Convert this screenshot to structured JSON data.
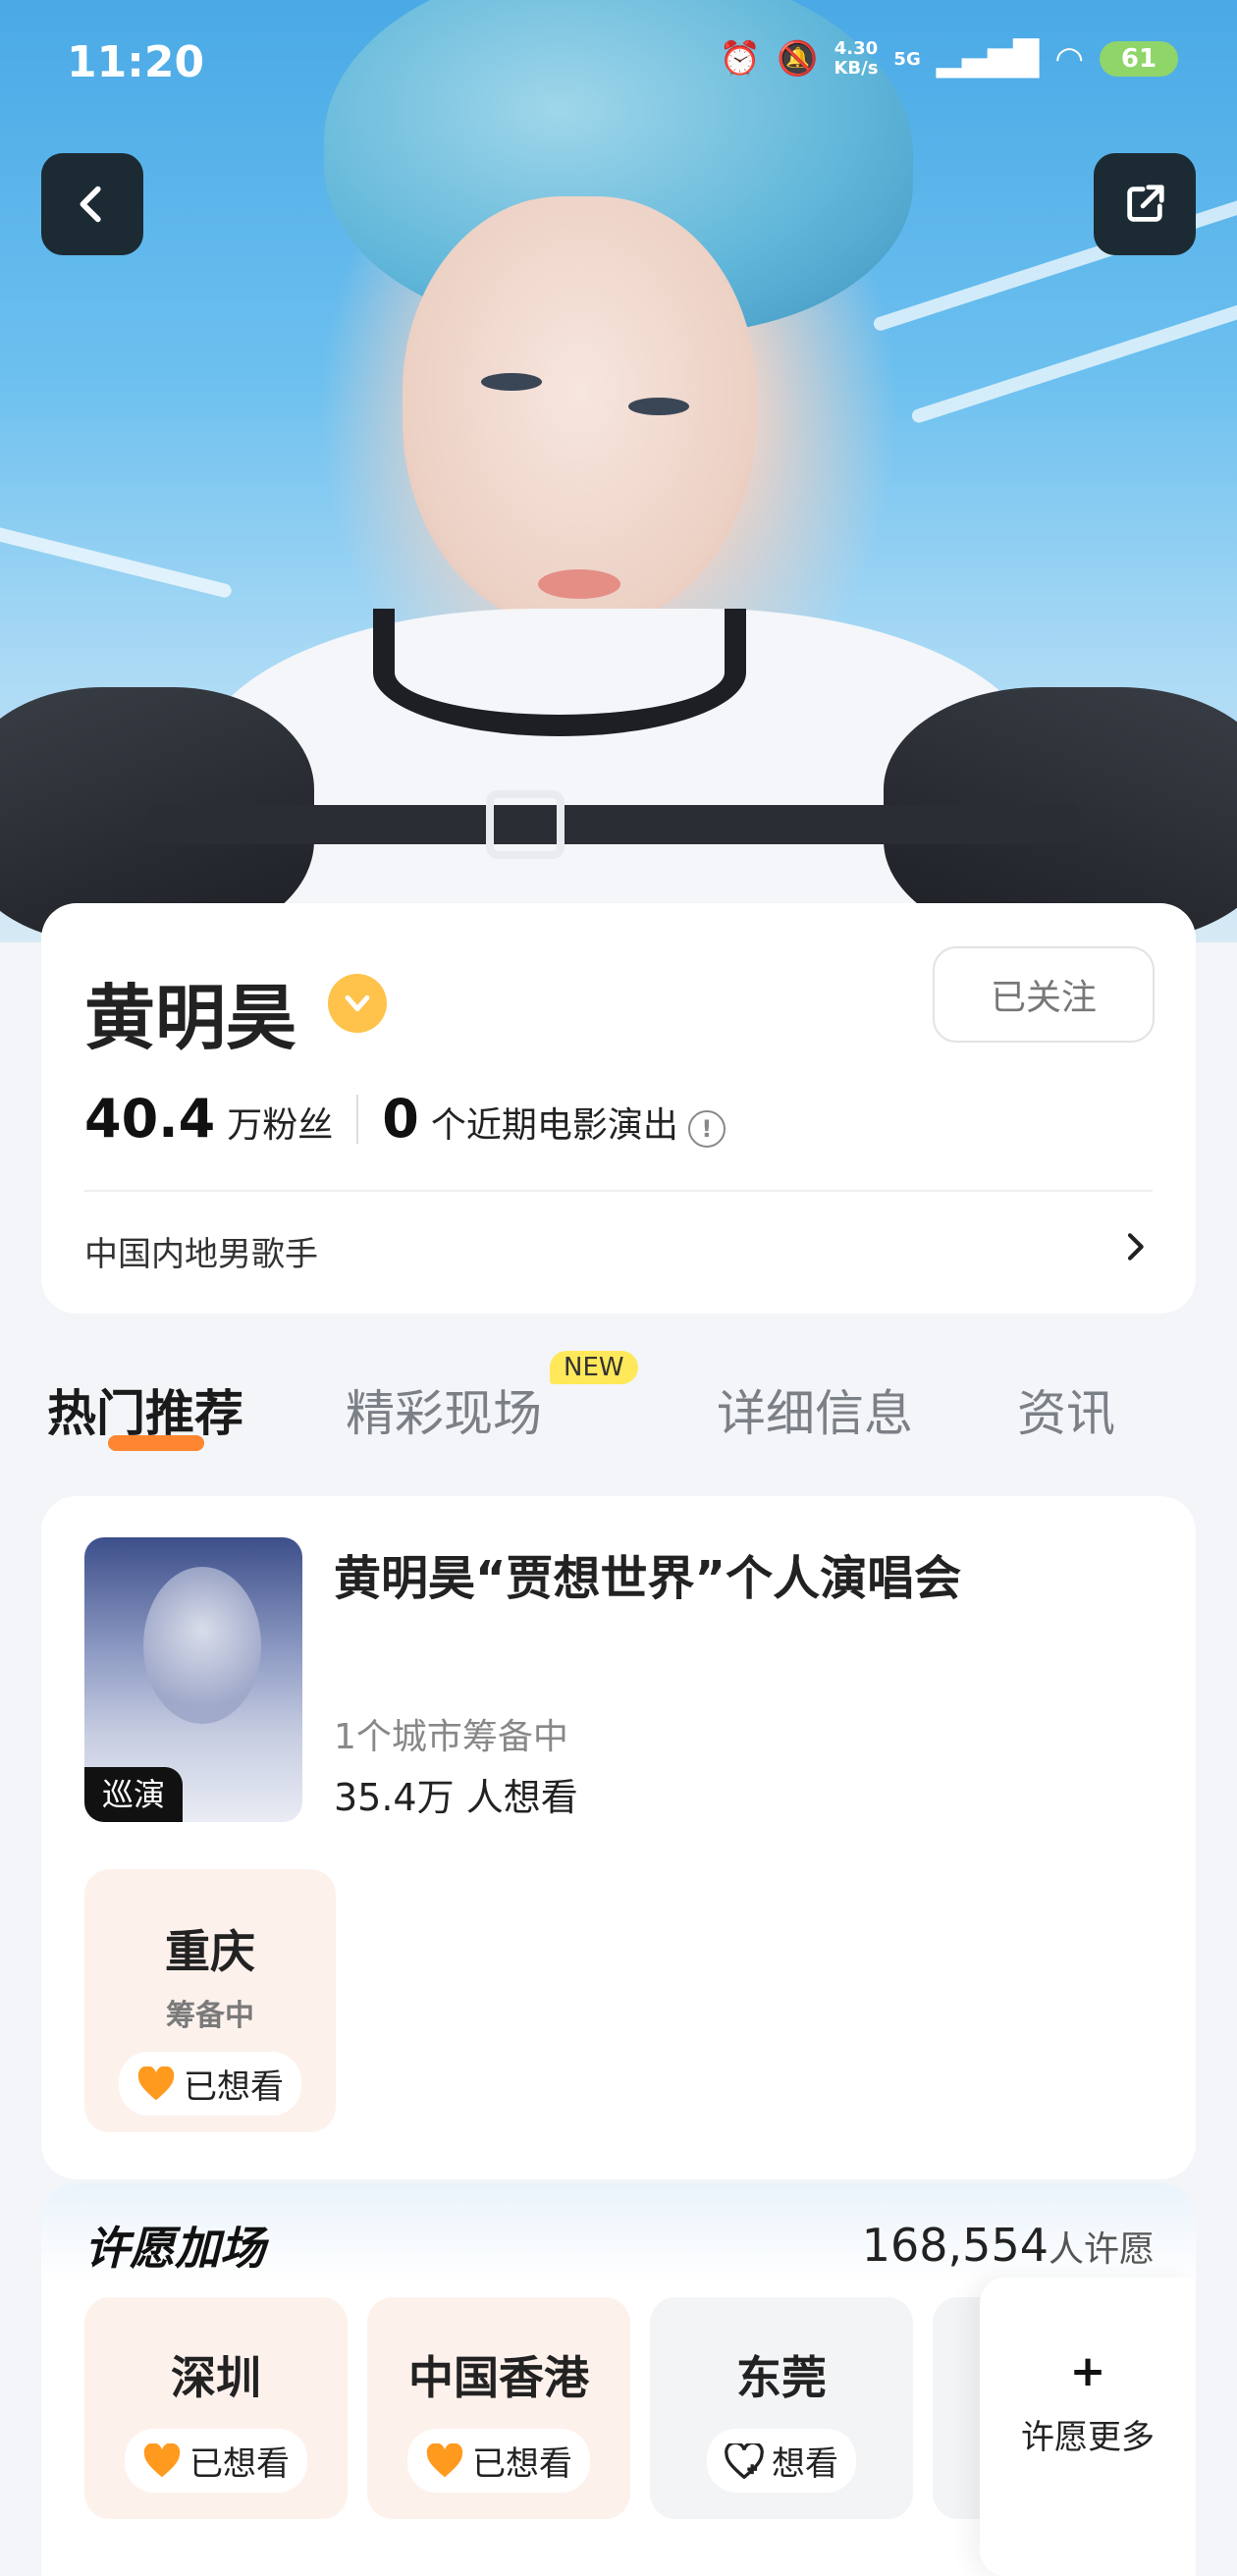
{
  "status_bar": {
    "time": "11:20",
    "net_speed_value": "4.30",
    "net_speed_unit": "KB/s",
    "network": "5G",
    "battery": "61"
  },
  "artist": {
    "name": "黄明昊",
    "follow_label": "已关注",
    "fans_count": "40.4",
    "fans_unit": "万粉丝",
    "recent_count": "0",
    "recent_label": "个近期电影演出",
    "description": "中国内地男歌手"
  },
  "tabs": [
    {
      "label": "热门推荐",
      "active": true
    },
    {
      "label": "精彩现场",
      "badge": "NEW"
    },
    {
      "label": "详细信息"
    },
    {
      "label": "资讯"
    }
  ],
  "concert": {
    "title": "黄明昊“贾想世界”个人演唱会",
    "poster_tag": "巡演",
    "cities_status": "1个城市筹备中",
    "want_count": "35.4万 人想看",
    "city": {
      "name": "重庆",
      "status": "筹备中",
      "want_label": "已想看"
    }
  },
  "wish": {
    "title": "许愿加场",
    "count": "168,554",
    "count_unit": "人许愿",
    "cities": [
      {
        "name": "深圳",
        "want_label": "已想看"
      },
      {
        "name": "中国香港",
        "want_label": "已想看"
      },
      {
        "name": "东莞",
        "want_label": "想看"
      }
    ],
    "more_plus": "+",
    "more_label": "许愿更多"
  },
  "colors": {
    "accent_orange": "#ff7a1a",
    "heart": "#ff9a1f",
    "badge_yellow": "#ffe85a"
  }
}
